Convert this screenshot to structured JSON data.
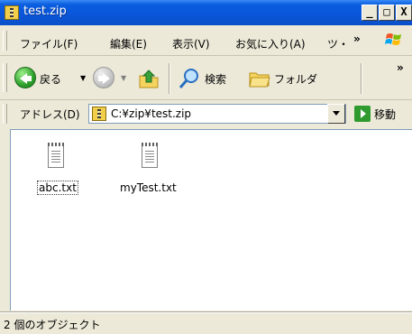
{
  "window": {
    "title": "test.zip",
    "buttons": {
      "minimize": "_",
      "maximize": "□",
      "close": "X"
    }
  },
  "menu": {
    "items": [
      "ファイル(F)",
      "編集(E)",
      "表示(V)",
      "お気に入り(A)",
      "ツ・"
    ],
    "overflow": "»"
  },
  "toolbar": {
    "back_label": "戻る",
    "search_label": "検索",
    "folders_label": "フォルダ",
    "overflow": "»"
  },
  "address": {
    "label": "アドレス(D)",
    "path": "C:¥zip¥test.zip",
    "go_label": "移動"
  },
  "files": [
    {
      "name": "abc.txt",
      "selected": true
    },
    {
      "name": "myTest.txt",
      "selected": false
    }
  ],
  "status": {
    "text": "2 個のオブジェクト"
  },
  "colors": {
    "titlebar": "#0a55d8",
    "face": "#ece9d8",
    "content_bg": "#ffffff"
  }
}
